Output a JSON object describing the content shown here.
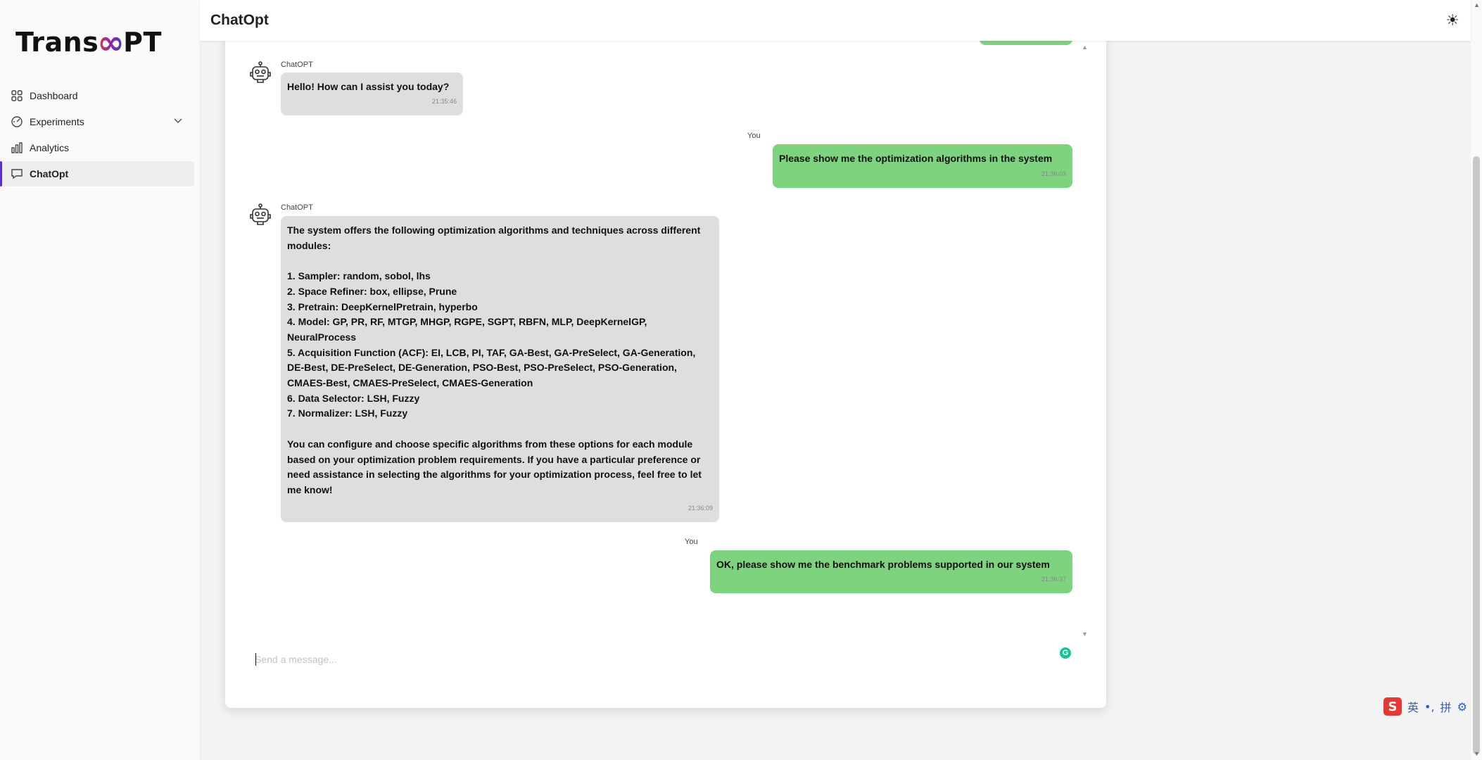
{
  "app": {
    "brand_left": "Trans",
    "brand_right": "PT"
  },
  "header": {
    "title": "ChatOpt",
    "theme_icon": "sun-icon"
  },
  "sidebar": {
    "items": [
      {
        "label": "Dashboard",
        "icon": "grid-icon"
      },
      {
        "label": "Experiments",
        "icon": "dial-icon"
      },
      {
        "label": "Analytics",
        "icon": "bar-chart-icon"
      },
      {
        "label": "ChatOpt",
        "icon": "chat-icon"
      }
    ]
  },
  "chat": {
    "messages": [
      {
        "role": "bot",
        "sender": "ChatOPT",
        "text": "Hello! How can I assist you today?",
        "time": "21:35:46"
      },
      {
        "role": "user",
        "sender": "You",
        "text": "Please show me the optimization algorithms in the system",
        "time": "21:36:03"
      },
      {
        "role": "bot",
        "sender": "ChatOPT",
        "text": "The system offers the following optimization algorithms and techniques across different modules:\n\n1. Sampler: random, sobol, lhs\n2. Space Refiner: box, ellipse, Prune\n3. Pretrain: DeepKernelPretrain, hyperbo\n4. Model: GP, PR, RF, MTGP, MHGP, RGPE, SGPT, RBFN, MLP, DeepKernelGP, NeuralProcess\n5. Acquisition Function (ACF): EI, LCB, PI, TAF, GA-Best, GA-PreSelect, GA-Generation, DE-Best, DE-PreSelect, DE-Generation, PSO-Best, PSO-PreSelect, PSO-Generation, CMAES-Best, CMAES-PreSelect, CMAES-Generation\n6. Data Selector: LSH, Fuzzy\n7. Normalizer: LSH, Fuzzy\n\nYou can configure and choose specific algorithms from these options for each module based on your optimization problem requirements. If you have a particular preference or need assistance in selecting the algorithms for your optimization process, feel free to let me know!",
        "time": "21:36:09"
      },
      {
        "role": "user",
        "sender": "You",
        "text": "OK, please show me the benchmark problems supported in our system",
        "time": "21:36:37"
      }
    ],
    "input_placeholder": "Send a message..."
  },
  "ime": {
    "logo": "S",
    "lang": "英",
    "punct": "•,",
    "mode": "拼",
    "settings": "⚙"
  },
  "colors": {
    "accent": "#5b2bd6",
    "user_bubble": "#7ed37f",
    "bot_bubble": "#dedede"
  }
}
